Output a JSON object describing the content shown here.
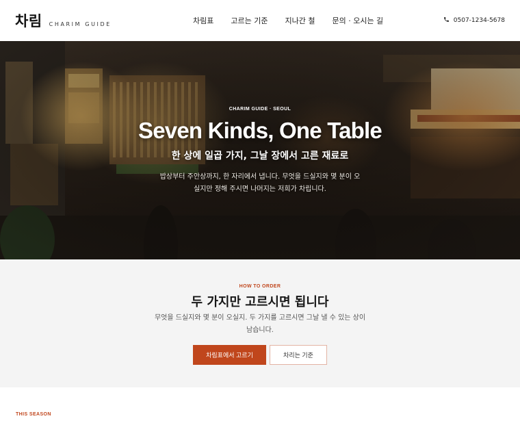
{
  "brand": {
    "name_ko": "차림",
    "name_en": "CHARIM GUIDE"
  },
  "nav": {
    "items": [
      {
        "label": "차림표"
      },
      {
        "label": "고르는 기준"
      },
      {
        "label": "지나간 철"
      },
      {
        "label": "문의 · 오시는 길"
      }
    ]
  },
  "header": {
    "phone": "0507-1234-5678",
    "phone_icon": "phone-icon"
  },
  "hero": {
    "eyebrow": "CHARIM GUIDE · SEOUL",
    "title": "Seven Kinds, One Table",
    "subtitle": "한 상에 일곱 가지, 그날 장에서 고른 재료로",
    "description": "밥상부터 주안상까지, 한 자리에서 냅니다. 무엇을 드실지와 몇 분이 오실지만 정해 주시면 나머지는 저희가 차립니다."
  },
  "how_to_order": {
    "eyebrow": "HOW TO ORDER",
    "title": "두 가지만 고르시면 됩니다",
    "description": "무엇을 드실지와 몇 분이 오실지. 두 가지를 고르시면 그날 낼 수 있는 상이 남습니다.",
    "primary_button": "차림표에서 고르기",
    "secondary_button": "차리는 기준"
  },
  "this_season": {
    "eyebrow": "THIS SEASON"
  },
  "colors": {
    "accent": "#c0461c",
    "section_bg": "#f4f4f4",
    "header_bg": "#ffffff"
  }
}
